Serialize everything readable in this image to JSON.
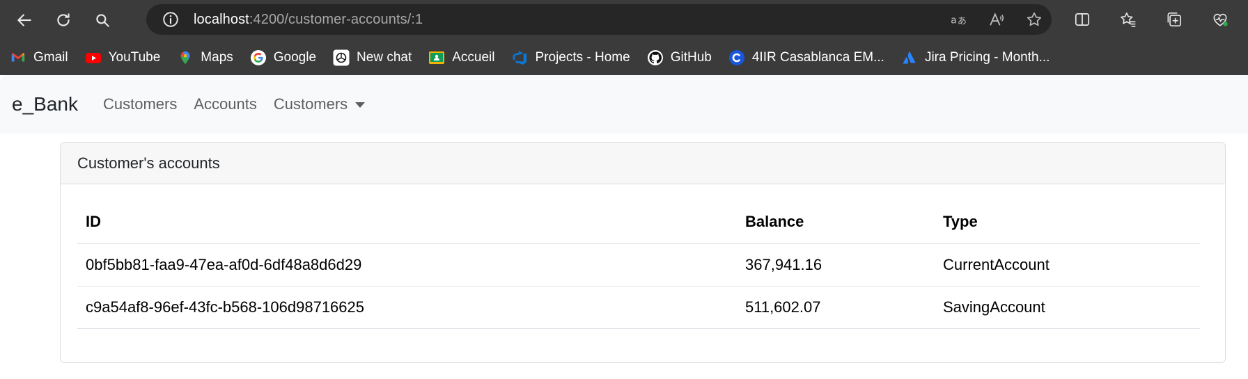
{
  "browser": {
    "url_host": "localhost",
    "url_path": ":4200/customer-accounts/:1",
    "bookmarks": [
      {
        "label": "Gmail",
        "icon": "gmail-icon"
      },
      {
        "label": "YouTube",
        "icon": "youtube-icon"
      },
      {
        "label": "Maps",
        "icon": "maps-icon"
      },
      {
        "label": "Google",
        "icon": "google-icon"
      },
      {
        "label": "New chat",
        "icon": "openai-icon"
      },
      {
        "label": "Accueil",
        "icon": "classroom-icon"
      },
      {
        "label": "Projects - Home",
        "icon": "azure-devops-icon"
      },
      {
        "label": "GitHub",
        "icon": "github-icon"
      },
      {
        "label": "4IIR Casablanca EM...",
        "icon": "c-logo-icon"
      },
      {
        "label": "Jira Pricing - Month...",
        "icon": "jira-icon"
      }
    ]
  },
  "navbar": {
    "brand": "e_Bank",
    "links": [
      "Customers",
      "Accounts"
    ],
    "dropdown": "Customers"
  },
  "card": {
    "title": "Customer's accounts",
    "columns": [
      "ID",
      "Balance",
      "Type"
    ],
    "rows": [
      [
        "0bf5bb81-faa9-47ea-af0d-6df48a8d6d29",
        "367,941.16",
        "CurrentAccount"
      ],
      [
        "c9a54af8-96ef-43fc-b568-106d98716625",
        "511,602.07",
        "SavingAccount"
      ]
    ]
  },
  "colors": {
    "chrome_bg": "#3b3b3b",
    "address_bg": "#262626",
    "navbar_bg": "#f8f9fa",
    "card_header_bg": "#f7f7f7"
  }
}
